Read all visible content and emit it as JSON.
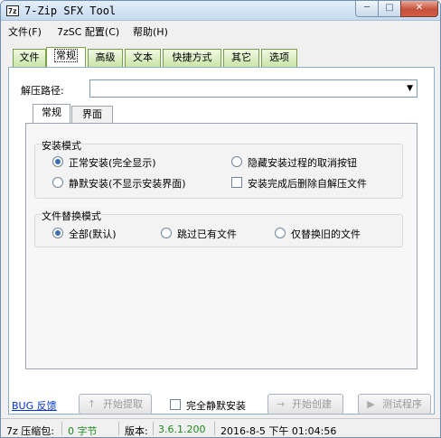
{
  "window": {
    "icon_text": "7z",
    "title": "7-Zip SFX Tool",
    "min_glyph": "─",
    "max_glyph": "□",
    "close_glyph": "✕"
  },
  "menu": [
    "文件(F)",
    "7zSC 配置(C)",
    "帮助(H)"
  ],
  "tabs": [
    "文件",
    "常规",
    "高级",
    "文本",
    "快捷方式",
    "其它",
    "选项"
  ],
  "active_tab": "常规",
  "extract_path": {
    "label": "解压路径:",
    "value": "",
    "dropdown_glyph": "▼"
  },
  "inner_tabs": [
    "常规",
    "界面"
  ],
  "install_mode": {
    "title": "安装模式",
    "options": [
      {
        "label": "正常安装(完全显示)",
        "selected": true
      },
      {
        "label": "隐藏安装过程的取消按钮",
        "type": "checkbox",
        "checked": false
      },
      {
        "label": "静默安装(不显示安装界面)",
        "selected": false
      },
      {
        "label": "安装完成后删除自解压文件",
        "type": "checkbox",
        "checked": false
      }
    ]
  },
  "file_replace": {
    "title": "文件替换模式",
    "options": [
      {
        "label": "全部(默认)",
        "selected": true
      },
      {
        "label": "跳过已有文件",
        "selected": false
      },
      {
        "label": "仅替换旧的文件",
        "selected": false
      }
    ]
  },
  "bottom": {
    "bug_link": "BUG 反馈",
    "start_extract": "开始提取",
    "silent_label": "完全静默安装",
    "start_create": "开始创建",
    "test_program": "测试程序",
    "extract_icon": "↑",
    "create_icon": "→",
    "test_icon": "▶"
  },
  "status": {
    "pkg_label": "7z 压缩包:",
    "pkg_value": "0 字节",
    "version_label": "版本:",
    "version_value": "3.6.1.200",
    "datetime": "2016-8-5 下午 01:04:56"
  }
}
